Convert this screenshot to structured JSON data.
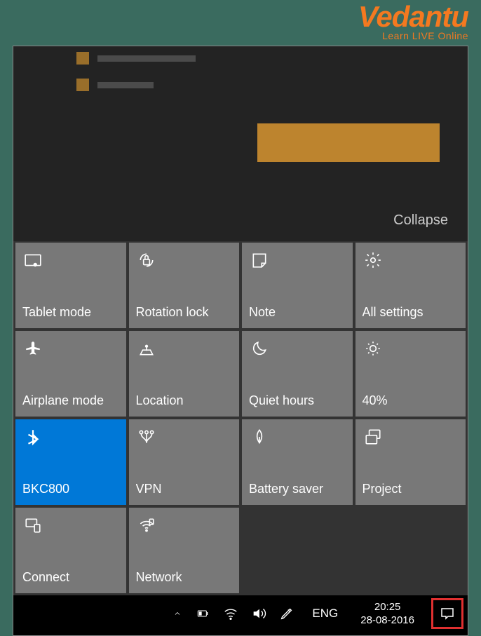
{
  "watermark": {
    "logo": "Vedantu",
    "tagline": "Learn LIVE Online"
  },
  "actionCenter": {
    "collapseLabel": "Collapse",
    "tiles": [
      {
        "id": "tablet-mode",
        "label": "Tablet mode",
        "active": false
      },
      {
        "id": "rotation-lock",
        "label": "Rotation lock",
        "active": false
      },
      {
        "id": "note",
        "label": "Note",
        "active": false
      },
      {
        "id": "all-settings",
        "label": "All settings",
        "active": false
      },
      {
        "id": "airplane-mode",
        "label": "Airplane mode",
        "active": false
      },
      {
        "id": "location",
        "label": "Location",
        "active": false
      },
      {
        "id": "quiet-hours",
        "label": "Quiet hours",
        "active": false
      },
      {
        "id": "brightness",
        "label": "40%",
        "active": false
      },
      {
        "id": "bluetooth",
        "label": "BKC800",
        "active": true
      },
      {
        "id": "vpn",
        "label": "VPN",
        "active": false
      },
      {
        "id": "battery-saver",
        "label": "Battery saver",
        "active": false
      },
      {
        "id": "project",
        "label": "Project",
        "active": false
      },
      {
        "id": "connect",
        "label": "Connect",
        "active": false
      },
      {
        "id": "network",
        "label": "Network",
        "active": false
      }
    ]
  },
  "taskbar": {
    "language": "ENG",
    "time": "20:25",
    "date": "28-08-2016"
  }
}
